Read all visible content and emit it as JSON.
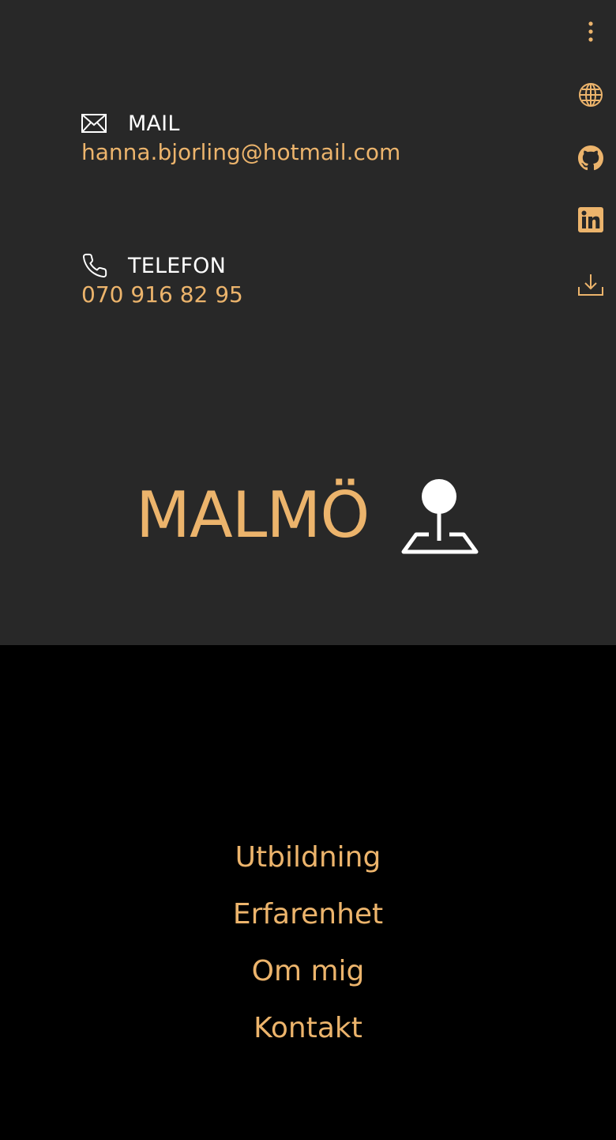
{
  "contact": {
    "mail": {
      "icon": "envelope-icon",
      "label": "MAIL",
      "value": "hanna.bjorling@hotmail.com"
    },
    "phone": {
      "icon": "phone-icon",
      "label": "TELEFON",
      "value": "070 916 82 95"
    }
  },
  "side_icons": [
    "more-vertical-icon",
    "globe-icon",
    "github-icon",
    "linkedin-icon",
    "download-icon"
  ],
  "location": {
    "city": "MALMÖ",
    "icon": "map-pin-icon"
  },
  "nav": {
    "items": [
      "Utbildning",
      "Erfarenhet",
      "Om mig",
      "Kontakt"
    ]
  },
  "colors": {
    "accent": "#ecb46c",
    "top_background": "#282828",
    "bottom_background": "#000000",
    "text_white": "#ffffff"
  }
}
